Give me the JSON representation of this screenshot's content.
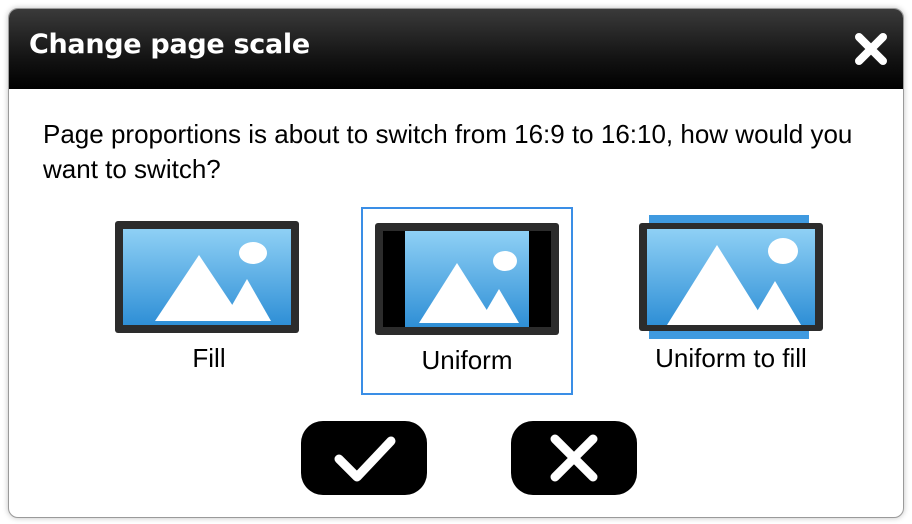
{
  "dialog": {
    "title": "Change page scale",
    "close_icon": "close-icon",
    "message": "Page proportions is about to switch from 16:9 to 16:10, how would you want to switch?",
    "options": [
      {
        "label": "Fill",
        "icon": "fill-scale-icon",
        "selected": false
      },
      {
        "label": "Uniform",
        "icon": "uniform-scale-icon",
        "selected": true
      },
      {
        "label": "Uniform to fill",
        "icon": "uniform-to-fill-scale-icon",
        "selected": false
      }
    ],
    "buttons": {
      "confirm_icon": "checkmark-icon",
      "cancel_icon": "x-icon"
    }
  },
  "colors": {
    "title_bar": "#000000",
    "selection_border": "#3a8ee6",
    "sky_blue": "#5ab0ea",
    "frame": "#2c2c2c"
  }
}
